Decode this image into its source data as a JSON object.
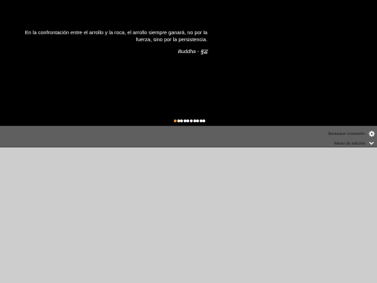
{
  "slideshow": {
    "quote_text": "En la confrontación entre el arrollo y la roca, el arrollo siempre ganará, no por la fuerza, sino por la persistencia.",
    "quote_author": "Buddha - बुद्ध",
    "slide_count": 10,
    "active_slide": 1,
    "colors": {
      "background": "#000000",
      "text": "#ffffff",
      "active_dot": "#f0902c",
      "inactive_dot": "#ffffff"
    }
  },
  "toolbar": {
    "restore_label": "Restaurar contenido",
    "restore_icon": "gear-icon",
    "edit_menu_label": "Menu de edición",
    "edit_menu_icon": "chevron-down-icon",
    "colors": {
      "background": "#5f5f5f",
      "text": "#151515",
      "icon": "#ffffff"
    }
  },
  "page": {
    "background": "#cdcdcd"
  }
}
